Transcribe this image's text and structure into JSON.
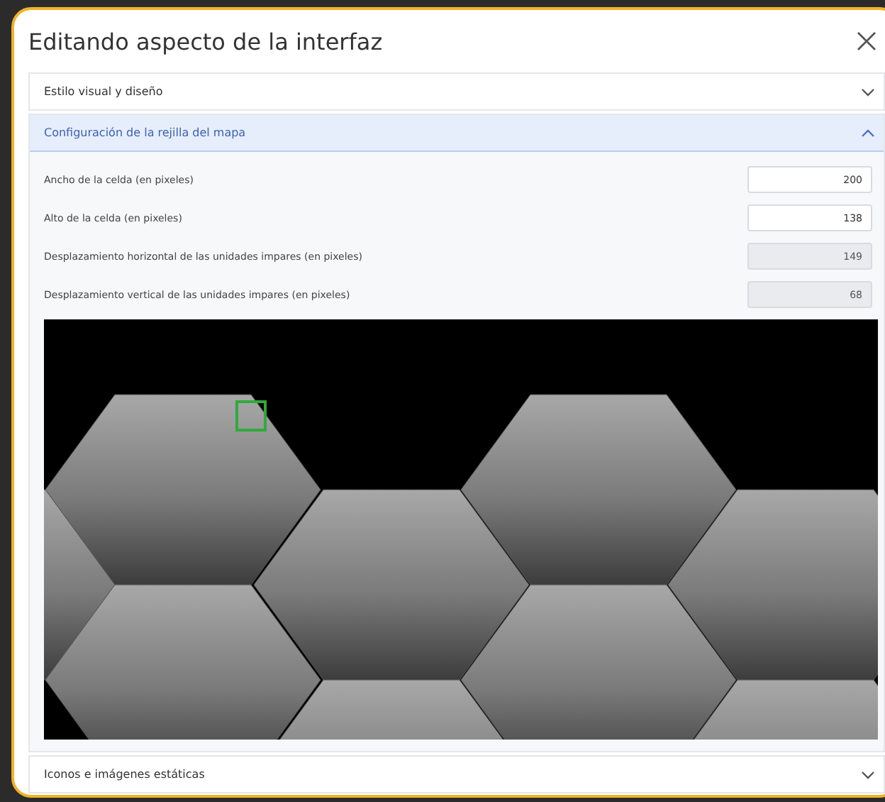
{
  "dialog": {
    "title": "Editando aspecto de la interfaz",
    "sections": [
      {
        "title": "Estilo visual y diseño",
        "expanded": false
      },
      {
        "title": "Configuración de la rejilla del mapa",
        "expanded": true,
        "fields": [
          {
            "label": "Ancho de la celda (en pixeles)",
            "value": "200",
            "disabled": false
          },
          {
            "label": "Alto de la celda (en pixeles)",
            "value": "138",
            "disabled": false
          },
          {
            "label": "Desplazamiento horizontal de las unidades impares (en pixeles)",
            "value": "149",
            "disabled": true
          },
          {
            "label": "Desplazamiento vertical de las unidades impares (en pixeles)",
            "value": "68",
            "disabled": true
          }
        ]
      },
      {
        "title": "Iconos e imágenes estáticas",
        "expanded": false
      }
    ]
  }
}
